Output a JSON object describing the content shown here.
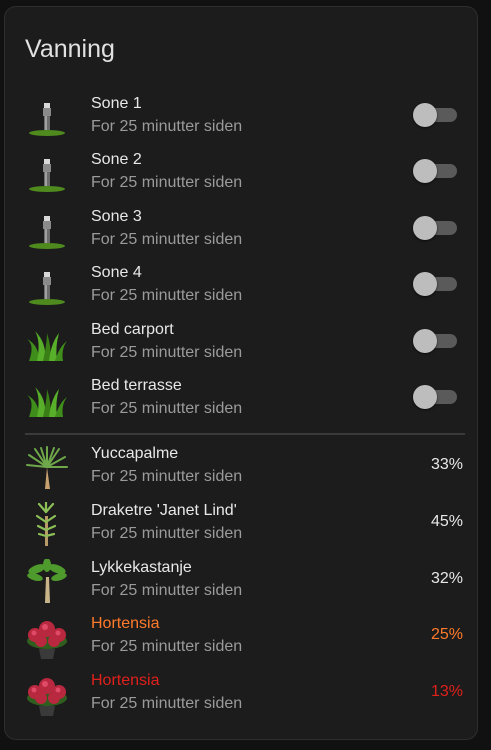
{
  "card": {
    "title": "Vanning"
  },
  "zones": [
    {
      "name": "Sone 1",
      "status": "For 25 minutter siden",
      "icon": "sprinkler-icon",
      "on": false
    },
    {
      "name": "Sone 2",
      "status": "For 25 minutter siden",
      "icon": "sprinkler-icon",
      "on": false
    },
    {
      "name": "Sone 3",
      "status": "For 25 minutter siden",
      "icon": "sprinkler-icon",
      "on": false
    },
    {
      "name": "Sone 4",
      "status": "For 25 minutter siden",
      "icon": "sprinkler-icon",
      "on": false
    },
    {
      "name": "Bed carport",
      "status": "For 25 minutter siden",
      "icon": "grass-icon",
      "on": false
    },
    {
      "name": "Bed terrasse",
      "status": "For 25 minutter siden",
      "icon": "grass-icon",
      "on": false
    }
  ],
  "plants": [
    {
      "name": "Yuccapalme",
      "status": "For 25 minutter siden",
      "value": "33%",
      "icon": "yucca-icon",
      "level": "normal"
    },
    {
      "name": "Draketre 'Janet Lind'",
      "status": "For 25 minutter siden",
      "value": "45%",
      "icon": "dracaena-icon",
      "level": "normal"
    },
    {
      "name": "Lykkekastanje",
      "status": "For 25 minutter siden",
      "value": "32%",
      "icon": "money-tree-icon",
      "level": "normal"
    },
    {
      "name": "Hortensia",
      "status": "For 25 minutter siden",
      "value": "25%",
      "icon": "hydrangea-icon",
      "level": "warning"
    },
    {
      "name": "Hortensia",
      "status": "For 25 minutter siden",
      "value": "13%",
      "icon": "hydrangea-icon",
      "level": "critical"
    }
  ],
  "colors": {
    "warning": "#ff7a2a",
    "critical": "#e0201b"
  }
}
